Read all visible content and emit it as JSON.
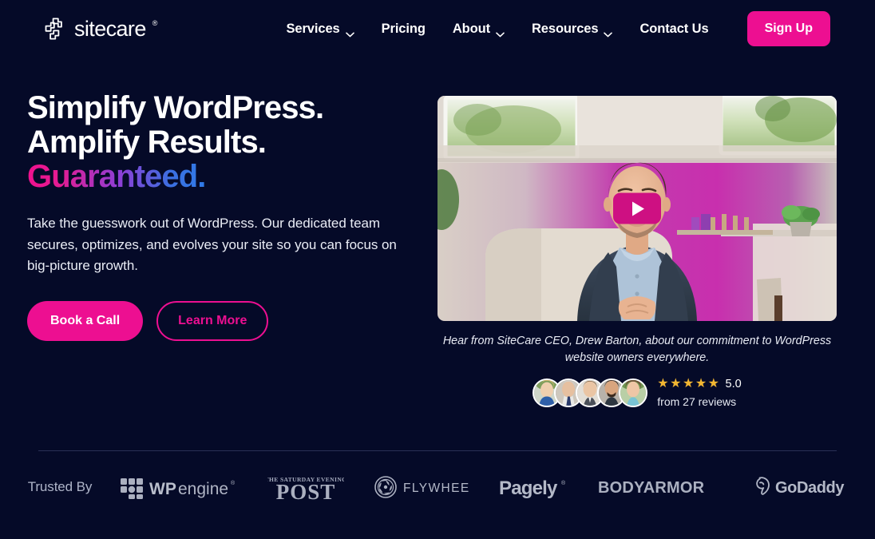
{
  "brand": {
    "name": "sitecare",
    "registered_mark": "®",
    "logo_icon": "sitecare-cross-logo"
  },
  "colors": {
    "background": "#050a28",
    "accent_pink": "#ED0F91",
    "play_button": "#CE1082",
    "star_gold": "#F2B632",
    "divider": "#2a3055",
    "gradient_start": "#F0118E",
    "gradient_mid": "#8C3FD6",
    "gradient_end": "#2F7BE8"
  },
  "nav": {
    "items": [
      {
        "label": "Services",
        "has_dropdown": true,
        "icon": "chevron-down-icon"
      },
      {
        "label": "Pricing",
        "has_dropdown": false
      },
      {
        "label": "About",
        "has_dropdown": true,
        "icon": "chevron-down-icon"
      },
      {
        "label": "Resources",
        "has_dropdown": true,
        "icon": "chevron-down-icon"
      },
      {
        "label": "Contact Us",
        "has_dropdown": false
      }
    ],
    "signup_label": "Sign Up"
  },
  "hero": {
    "headline_line1": "Simplify WordPress.",
    "headline_line2": "Amplify Results.",
    "headline_line3": "Guaranteed.",
    "subhead": "Take the guesswork out of WordPress. Our dedicated team secures, optimizes, and evolves your site so you can focus on big-picture growth.",
    "cta_primary": "Book a Call",
    "cta_secondary": "Learn More"
  },
  "video": {
    "play_icon": "play-icon",
    "caption": "Hear from SiteCare CEO, Drew Barton, about our commitment to WordPress website owners everywhere."
  },
  "reviews": {
    "avatar_count": 5,
    "avatars": [
      {
        "name": "reviewer-avatar-1"
      },
      {
        "name": "reviewer-avatar-2"
      },
      {
        "name": "reviewer-avatar-3"
      },
      {
        "name": "reviewer-avatar-4"
      },
      {
        "name": "reviewer-avatar-5"
      }
    ],
    "stars": "★★★★★",
    "star_count": 5,
    "score": "5.0",
    "count_text": "from 27 reviews"
  },
  "trusted_by": {
    "label": "Trusted By",
    "logos": [
      {
        "name": "wpengine",
        "bold_text": "WP",
        "light_text": "engine",
        "mark": "®"
      },
      {
        "name": "saturday-evening-post",
        "top_text": "THE SATURDAY EVENING",
        "main_text": "POST"
      },
      {
        "name": "flywheel",
        "text": "FLYWHEEL"
      },
      {
        "name": "pagely",
        "text": "Pagely",
        "mark": "®"
      },
      {
        "name": "bodyarmor",
        "text": "BODYARMOR"
      },
      {
        "name": "godaddy",
        "text": "GoDaddy"
      }
    ]
  }
}
